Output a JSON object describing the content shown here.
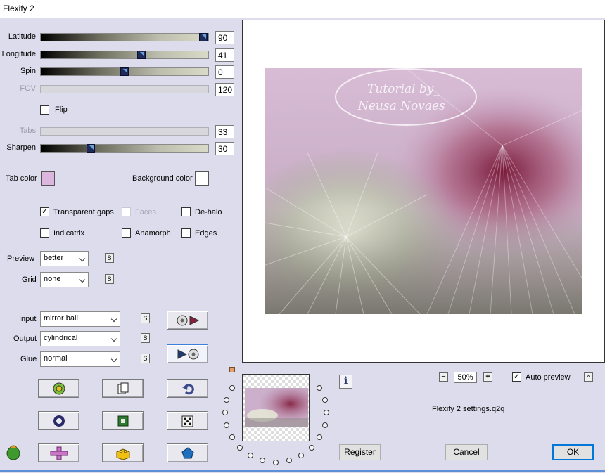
{
  "window": {
    "title": "Flexify 2"
  },
  "sliders": [
    {
      "label": "Latitude",
      "value": "90",
      "level": 0.97,
      "enabled": true
    },
    {
      "label": "Longitude",
      "value": "41",
      "level": 0.6,
      "enabled": true
    },
    {
      "label": "Spin",
      "value": "0",
      "level": 0.5,
      "enabled": true
    },
    {
      "label": "FOV",
      "value": "120",
      "level": null,
      "enabled": false
    },
    {
      "label": "Tabs",
      "value": "33",
      "level": null,
      "enabled": false
    },
    {
      "label": "Sharpen",
      "value": "30",
      "level": 0.3,
      "enabled": true
    }
  ],
  "flip": {
    "label": "Flip",
    "checked": false
  },
  "colors": {
    "tab_label": "Tab color",
    "tab_color": "#dcb6dc",
    "bg_label": "Background color",
    "bg_color": "#ffffff",
    "accent": "#0078d7"
  },
  "options": {
    "transparent_gaps": {
      "label": "Transparent gaps",
      "checked": true
    },
    "faces": {
      "label": "Faces",
      "checked": false
    },
    "de_halo": {
      "label": "De-halo",
      "checked": false
    },
    "indicatrix": {
      "label": "Indicatrix",
      "checked": false
    },
    "anamorph": {
      "label": "Anamorph",
      "checked": false
    },
    "edges": {
      "label": "Edges",
      "checked": false
    }
  },
  "preview": {
    "label": "Preview",
    "value": "better"
  },
  "grid": {
    "label": "Grid",
    "value": "none"
  },
  "s_button": "S",
  "input": {
    "label": "Input",
    "value": "mirror ball"
  },
  "output": {
    "label": "Output",
    "value": "cylindrical"
  },
  "glue": {
    "label": "Glue",
    "value": "normal"
  },
  "watermark": {
    "line1": "Tutorial by_",
    "line2": "Neusa Novaes"
  },
  "zoom": {
    "minus": "−",
    "value": "50%",
    "plus": "+"
  },
  "auto_preview": {
    "label": "Auto preview",
    "checked": true,
    "expand_glyph": "^"
  },
  "settings_file": "Flexify 2 settings.q2q",
  "info_glyph": "i",
  "buttons": {
    "register": "Register",
    "cancel": "Cancel",
    "ok": "OK"
  },
  "icons": [
    "output-to-input-icon",
    "input-to-output-icon",
    "random-color-icon",
    "copy-icon",
    "undo-icon",
    "ring-icon",
    "square-icon",
    "dice-icon",
    "plugin-logo-icon",
    "cross-icon",
    "brick-icon",
    "pentagon-icon",
    "info-icon"
  ]
}
